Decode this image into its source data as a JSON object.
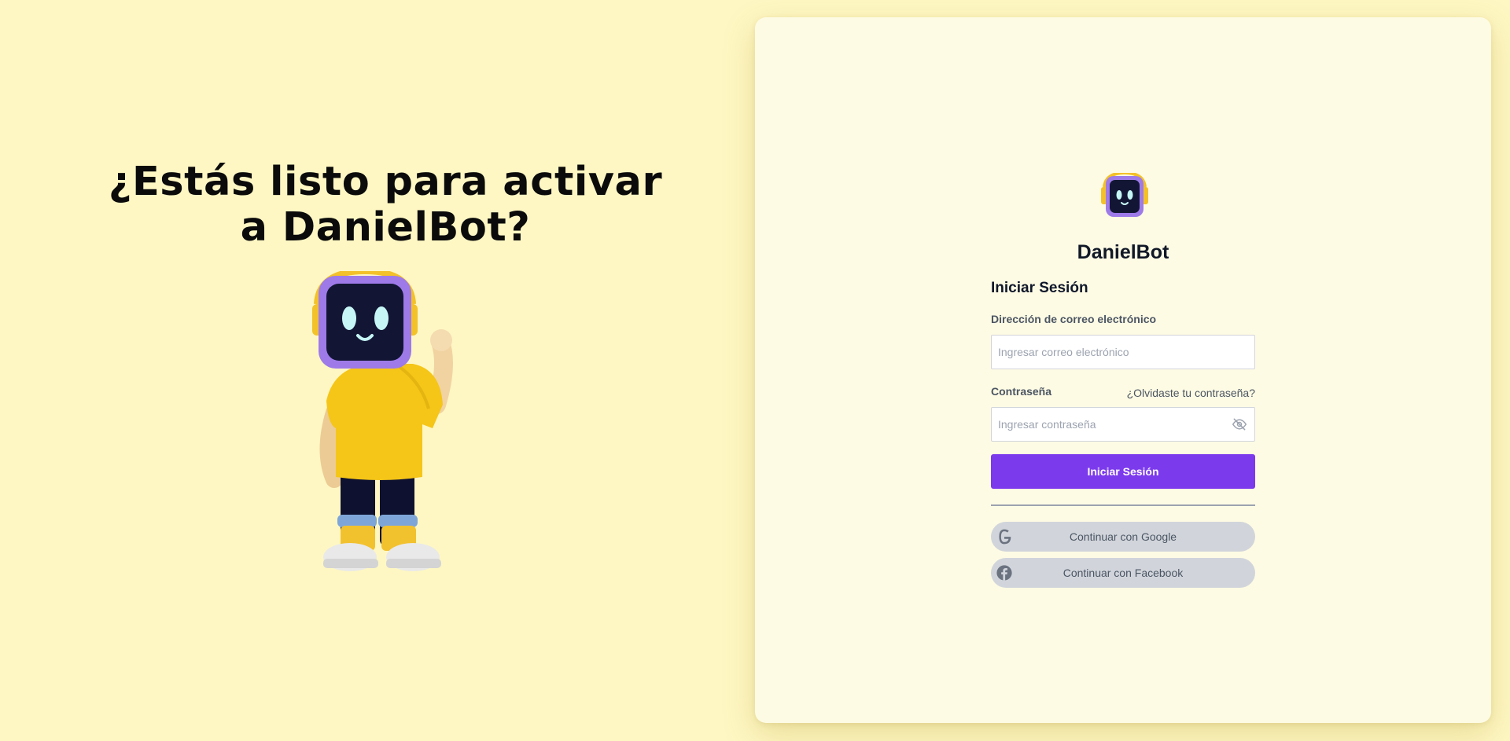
{
  "hero": {
    "title_line1": "¿Estás listo para activar",
    "title_line2": "a DanielBot?",
    "mascot_icon": "robot-mascot-waving"
  },
  "brand": {
    "name": "DanielBot",
    "logo_icon": "robot-head-icon"
  },
  "login": {
    "title": "Iniciar Sesión",
    "email_label": "Dirección de correo electrónico",
    "email_placeholder": "Ingresar correo electrónico",
    "email_value": "",
    "password_label": "Contraseña",
    "forgot_link": "¿Olvidaste tu contraseña?",
    "password_placeholder": "Ingresar contraseña",
    "password_value": "",
    "password_toggle_icon": "eye-off-icon",
    "submit_label": "Iniciar Sesión"
  },
  "social": {
    "google_label": "Continuar con Google",
    "google_icon": "google-icon",
    "facebook_label": "Continuar con Facebook",
    "facebook_icon": "facebook-icon"
  },
  "colors": {
    "page_background": "#fef7c3",
    "panel_background": "#fefbe4",
    "accent": "#7c3aed",
    "social_button": "#d1d5db",
    "mascot_shirt": "#f5c518",
    "mascot_frame": "#9d7ae8"
  }
}
